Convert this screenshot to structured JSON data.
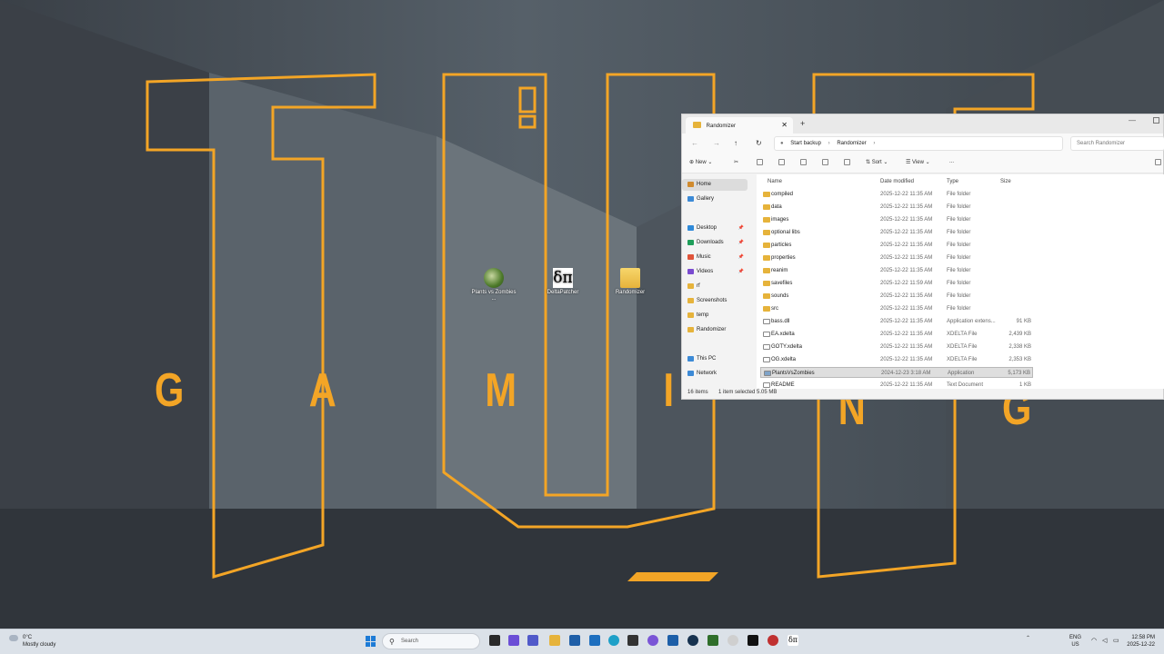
{
  "desktop": {
    "wallpaper_letters": [
      "G",
      "A",
      "M",
      "I",
      "N",
      "G"
    ],
    "icons": [
      {
        "label": "Plants vs Zombies ...",
        "icon": "pvz-icon"
      },
      {
        "label": "DeltaPatcher",
        "icon": "delta-patcher-icon",
        "glyph": "δπ"
      },
      {
        "label": "Randomizer",
        "icon": "folder-icon"
      }
    ]
  },
  "explorer": {
    "tab_title": "Randomizer",
    "new_tab": "+",
    "breadcrumb": [
      "Start backup",
      "Randomizer"
    ],
    "search_placeholder": "Search Randomizer",
    "toolbar": {
      "new": "New",
      "sort": "Sort",
      "view": "View",
      "more": "..."
    },
    "nav": [
      {
        "label": "Home",
        "icon": "home-icon"
      },
      {
        "label": "Gallery",
        "icon": "gallery-icon"
      },
      {
        "label": "Desktop",
        "icon": "desktop-icon"
      },
      {
        "label": "Downloads",
        "icon": "downloads-icon"
      },
      {
        "label": "Music",
        "icon": "music-icon"
      },
      {
        "label": "Videos",
        "icon": "videos-icon"
      },
      {
        "label": "rf",
        "icon": "folder-icon"
      },
      {
        "label": "Screenshots",
        "icon": "folder-icon"
      },
      {
        "label": "temp",
        "icon": "folder-icon"
      },
      {
        "label": "Randomizer",
        "icon": "folder-icon"
      },
      {
        "label": "This PC",
        "icon": "pc-icon"
      },
      {
        "label": "Network",
        "icon": "network-icon"
      }
    ],
    "columns": [
      "Name",
      "Date modified",
      "Type",
      "Size"
    ],
    "files": [
      {
        "name": "compiled",
        "date": "2025-12-22 11:35 AM",
        "type": "File folder",
        "size": "",
        "kind": "folder"
      },
      {
        "name": "data",
        "date": "2025-12-22 11:35 AM",
        "type": "File folder",
        "size": "",
        "kind": "folder"
      },
      {
        "name": "images",
        "date": "2025-12-22 11:35 AM",
        "type": "File folder",
        "size": "",
        "kind": "folder"
      },
      {
        "name": "optional libs",
        "date": "2025-12-22 11:35 AM",
        "type": "File folder",
        "size": "",
        "kind": "folder"
      },
      {
        "name": "particles",
        "date": "2025-12-22 11:35 AM",
        "type": "File folder",
        "size": "",
        "kind": "folder"
      },
      {
        "name": "properties",
        "date": "2025-12-22 11:35 AM",
        "type": "File folder",
        "size": "",
        "kind": "folder"
      },
      {
        "name": "reanim",
        "date": "2025-12-22 11:35 AM",
        "type": "File folder",
        "size": "",
        "kind": "folder"
      },
      {
        "name": "savefiles",
        "date": "2025-12-22 11:59 AM",
        "type": "File folder",
        "size": "",
        "kind": "folder"
      },
      {
        "name": "sounds",
        "date": "2025-12-22 11:35 AM",
        "type": "File folder",
        "size": "",
        "kind": "folder"
      },
      {
        "name": "src",
        "date": "2025-12-22 11:35 AM",
        "type": "File folder",
        "size": "",
        "kind": "folder"
      },
      {
        "name": "bass.dll",
        "date": "2025-12-22 11:35 AM",
        "type": "Application extens...",
        "size": "91 KB",
        "kind": "file"
      },
      {
        "name": "EA.xdelta",
        "date": "2025-12-22 11:35 AM",
        "type": "XDELTA File",
        "size": "2,439 KB",
        "kind": "file"
      },
      {
        "name": "GOTY.xdelta",
        "date": "2025-12-22 11:35 AM",
        "type": "XDELTA File",
        "size": "2,338 KB",
        "kind": "file"
      },
      {
        "name": "OG.xdelta",
        "date": "2025-12-22 11:35 AM",
        "type": "XDELTA File",
        "size": "2,353 KB",
        "kind": "file"
      },
      {
        "name": "PlantsVsZombies",
        "date": "2024-12-23 3:18 AM",
        "type": "Application",
        "size": "5,173 KB",
        "kind": "app",
        "selected": true
      },
      {
        "name": "README",
        "date": "2025-12-22 11:35 AM",
        "type": "Text Document",
        "size": "1 KB",
        "kind": "file"
      }
    ],
    "status": {
      "count": "16 items",
      "selection": "1 item selected  5.05 MB"
    }
  },
  "taskbar": {
    "weather_temp": "0°C",
    "weather_desc": "Mostly cloudy",
    "search_placeholder": "Search",
    "lang_top": "ENG",
    "lang_bottom": "US",
    "time": "12:58 PM",
    "date": "2025-12-22"
  },
  "colors": {
    "accent": "#f3a526",
    "explorer_bg": "#f3f3f3",
    "taskbar_bg": "#dbe1e8"
  }
}
